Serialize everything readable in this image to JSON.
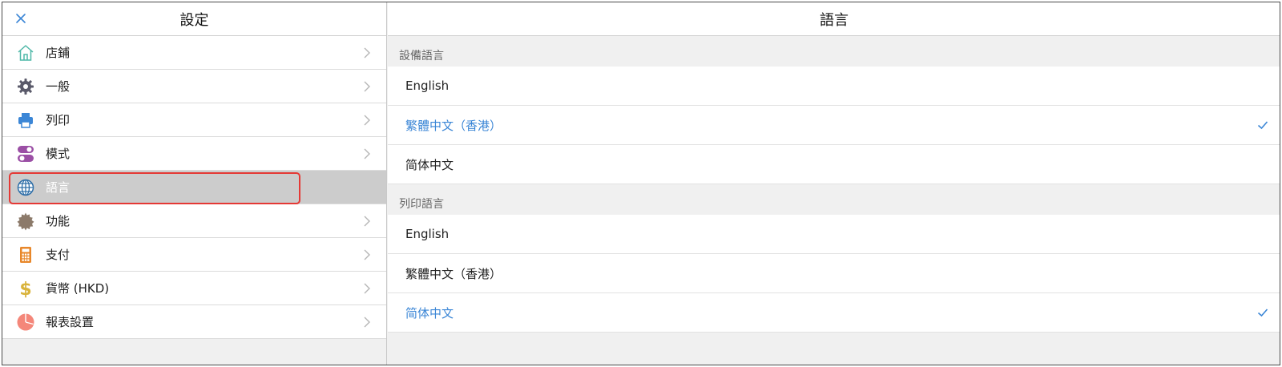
{
  "left": {
    "title": "設定",
    "items": [
      {
        "label": "店鋪",
        "icon": "home-icon",
        "selected": false
      },
      {
        "label": "一般",
        "icon": "gear-icon",
        "selected": false
      },
      {
        "label": "列印",
        "icon": "printer-icon",
        "selected": false
      },
      {
        "label": "模式",
        "icon": "toggle-icon",
        "selected": false
      },
      {
        "label": "語言",
        "icon": "globe-icon",
        "selected": true
      },
      {
        "label": "功能",
        "icon": "badge-icon",
        "selected": false
      },
      {
        "label": "支付",
        "icon": "calculator-icon",
        "selected": false
      },
      {
        "label": "貨幣 (HKD)",
        "icon": "dollar-icon",
        "selected": false
      },
      {
        "label": "報表設置",
        "icon": "pie-chart-icon",
        "selected": false
      }
    ]
  },
  "right": {
    "title": "語言",
    "device_section": {
      "label": "設備語言",
      "options": [
        "English",
        "繁體中文（香港）",
        "简体中文"
      ],
      "selected_index": 1
    },
    "print_section": {
      "label": "列印語言",
      "options": [
        "English",
        "繁體中文（香港）",
        "简体中文"
      ],
      "selected_index": 2
    }
  },
  "colors": {
    "accent": "#3b86d6",
    "selected_row": "#cccccc",
    "highlight_border": "#e53935"
  }
}
